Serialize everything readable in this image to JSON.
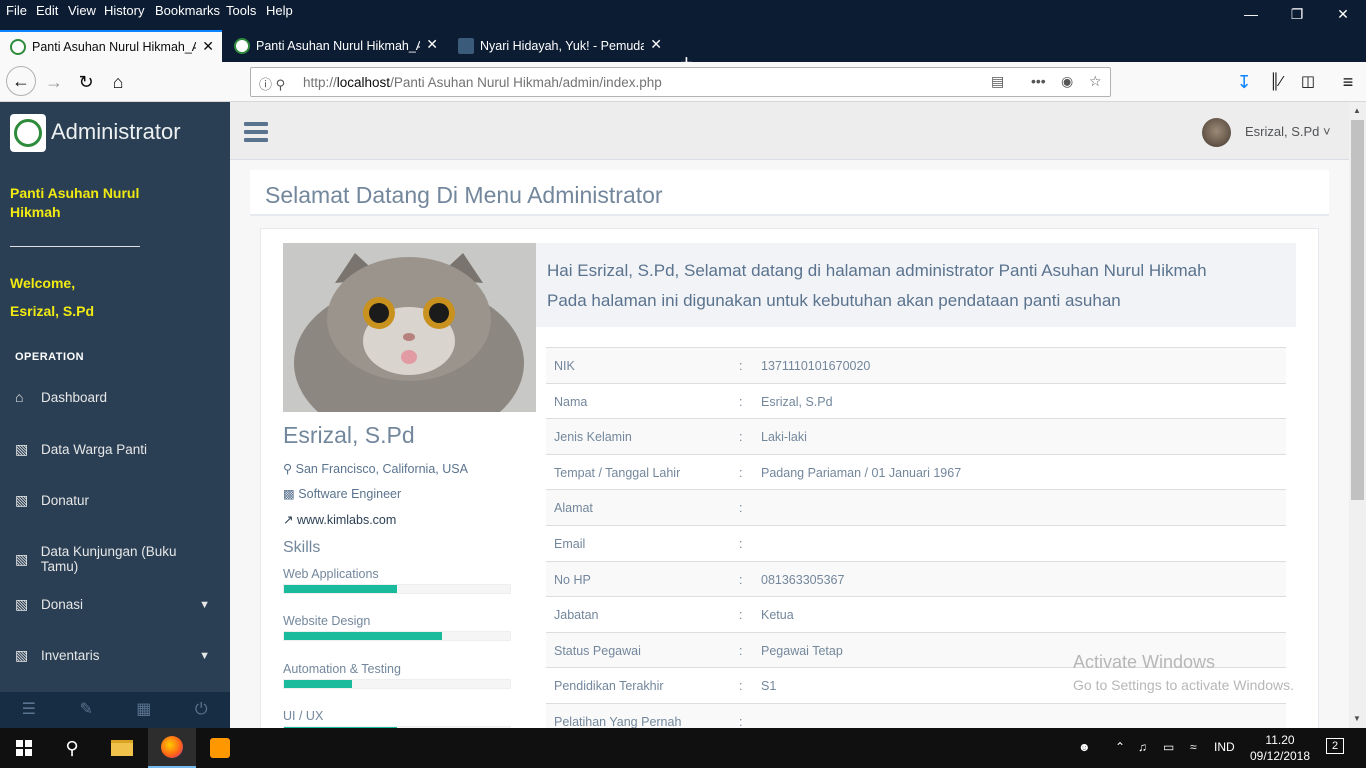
{
  "browser": {
    "menu": [
      "File",
      "Edit",
      "View",
      "History",
      "Bookmarks",
      "Tools",
      "Help"
    ],
    "tabs": [
      {
        "title": "Panti Asuhan Nurul Hikmah_Ad",
        "active": true
      },
      {
        "title": "Panti Asuhan Nurul Hikmah_Ad",
        "active": false
      },
      {
        "title": "Nyari Hidayah, Yuk! - Pemuda |",
        "active": false
      }
    ],
    "url_prefix": "http://",
    "url_host": "localhost",
    "url_path": "/Panti Asuhan Nurul Hikmah/admin/index.php"
  },
  "sidebar": {
    "brand": "Administrator",
    "org": "Panti Asuhan Nurul Hikmah",
    "welcome": "Welcome,",
    "user": "Esrizal, S.Pd",
    "section": "OPERATION",
    "items": [
      {
        "label": "Dashboard",
        "icon": "home-icon"
      },
      {
        "label": "Data Warga Panti",
        "icon": "bar-chart-icon"
      },
      {
        "label": "Donatur",
        "icon": "bar-chart-icon"
      },
      {
        "label": "Data Kunjungan (Buku Tamu)",
        "icon": "bar-chart-icon"
      },
      {
        "label": "Donasi",
        "icon": "bar-chart-icon",
        "dropdown": true
      },
      {
        "label": "Inventaris",
        "icon": "bar-chart-icon",
        "dropdown": true
      }
    ]
  },
  "topnav": {
    "user": "Esrizal, S.Pd"
  },
  "page": {
    "title": "Selamat Datang Di Menu Administrator",
    "greeting_line1": "Hai Esrizal, S.Pd, Selamat datang di halaman administrator Panti Asuhan Nurul Hikmah",
    "greeting_line2": "Pada halaman ini digunakan untuk kebutuhan akan pendataan panti asuhan"
  },
  "profile": {
    "name": "Esrizal, S.Pd",
    "location": "San Francisco, California, USA",
    "job": "Software Engineer",
    "website": "www.kimlabs.com",
    "skills_title": "Skills",
    "skills": [
      {
        "label": "Web Applications",
        "percent": 50
      },
      {
        "label": "Website Design",
        "percent": 70
      },
      {
        "label": "Automation & Testing",
        "percent": 30
      },
      {
        "label": "UI / UX",
        "percent": 50
      }
    ]
  },
  "details": [
    {
      "key": "NIK",
      "value": "1371110101670020"
    },
    {
      "key": "Nama",
      "value": "Esrizal, S.Pd"
    },
    {
      "key": "Jenis Kelamin",
      "value": "Laki-laki"
    },
    {
      "key": "Tempat / Tanggal Lahir",
      "value": "Padang Pariaman / 01 Januari 1967"
    },
    {
      "key": "Alamat",
      "value": ""
    },
    {
      "key": "Email",
      "value": ""
    },
    {
      "key": "No HP",
      "value": "081363305367"
    },
    {
      "key": "Jabatan",
      "value": "Ketua"
    },
    {
      "key": "Status Pegawai",
      "value": "Pegawai Tetap"
    },
    {
      "key": "Pendidikan Terakhir",
      "value": "S1"
    },
    {
      "key": "Pelatihan Yang Pernah",
      "value": ""
    }
  ],
  "watermark": {
    "line1": "Activate Windows",
    "line2": "Go to Settings to activate Windows."
  },
  "taskbar": {
    "lang": "IND",
    "time": "11.20",
    "date": "09/12/2018",
    "notifications": "2"
  }
}
